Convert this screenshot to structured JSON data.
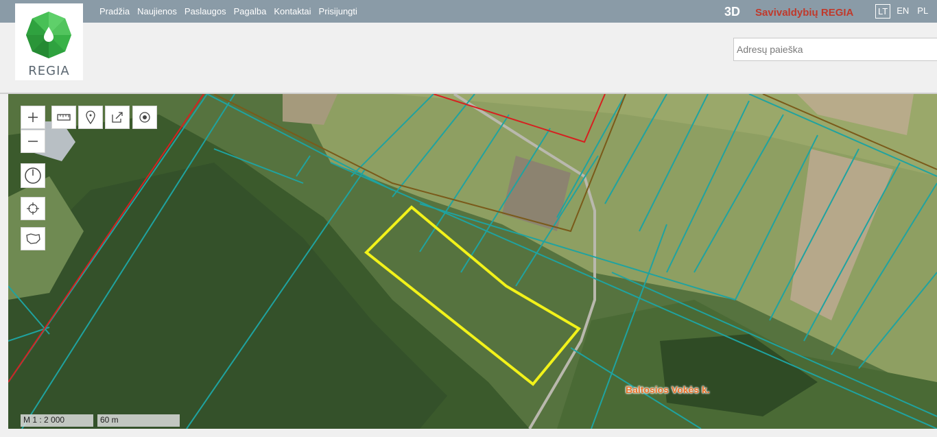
{
  "logo": {
    "text": "REGIA"
  },
  "nav": {
    "items": [
      "Pradžia",
      "Naujienos",
      "Paslaugos",
      "Pagalba",
      "Kontaktai",
      "Prisijungti"
    ]
  },
  "header": {
    "btn_3d": "3D",
    "brand": "Savivaldybių REGIA",
    "langs": [
      "LT",
      "EN",
      "PL"
    ]
  },
  "search": {
    "placeholder": "Adresų paieška"
  },
  "map": {
    "scale": "M 1 : 2 000",
    "distance": "60 m",
    "place_label": "Baltosios Vokės k.",
    "colors": {
      "parcel_border": "#1fa3a0",
      "highlight": "#f2f21a",
      "red_line": "#d62020",
      "brown_line": "#7a5a1a",
      "forest": "#3f5e2f",
      "field": "#8fa266"
    }
  },
  "toolbar": {
    "zoom_in": "zoom-in-icon",
    "zoom_out": "zoom-out-icon",
    "measure": "ruler-icon",
    "marker": "marker-icon",
    "share": "share-icon",
    "locate": "target-icon",
    "clock": "clock-icon",
    "crosshair": "crosshair-icon",
    "area": "area-icon"
  }
}
